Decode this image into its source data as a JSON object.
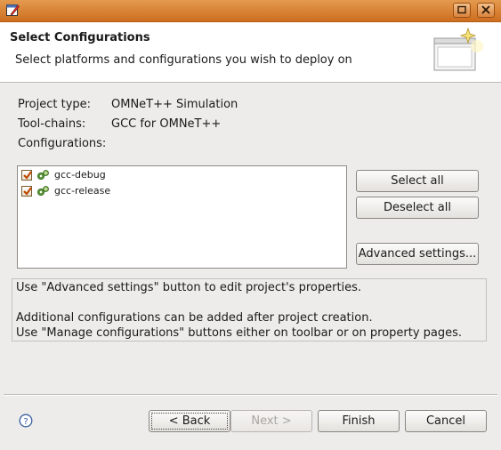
{
  "window": {
    "title": ""
  },
  "header": {
    "title": "Select Configurations",
    "description": "Select platforms and configurations you wish to deploy on"
  },
  "fields": {
    "project_type_label": "Project type:",
    "project_type_value": "OMNeT++ Simulation",
    "toolchains_label": "Tool-chains:",
    "toolchains_value": "GCC for OMNeT++",
    "configurations_label": "Configurations:"
  },
  "configurations": [
    {
      "label": "gcc-debug",
      "checked": true
    },
    {
      "label": "gcc-release",
      "checked": true
    }
  ],
  "side_buttons": {
    "select_all": "Select all",
    "deselect_all": "Deselect all",
    "advanced": "Advanced settings..."
  },
  "info": {
    "line1": "Use \"Advanced settings\" button to edit project's properties.",
    "line2": "Additional configurations can be added after project creation.",
    "line3": "Use \"Manage configurations\" buttons either on toolbar or on property pages."
  },
  "footer": {
    "back": "< Back",
    "next": "Next >",
    "finish": "Finish",
    "cancel": "Cancel"
  },
  "icons": {
    "app": "edit-window-icon",
    "maximize": "maximize-icon",
    "close": "close-icon",
    "wizard": "wizard-banner-icon",
    "config": "gears-icon",
    "help": "help-icon"
  },
  "colors": {
    "titlebar": "#d97b2e",
    "checkbox_mark": "#c04a00"
  }
}
